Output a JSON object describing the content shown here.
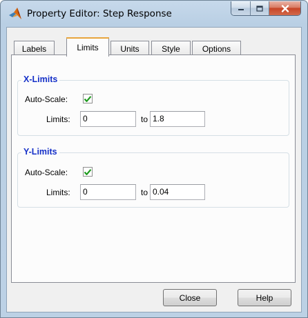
{
  "window": {
    "title": "Property Editor: Step Response",
    "controls": {
      "minimize": "minimize",
      "maximize": "maximize",
      "close": "close"
    }
  },
  "tabs": [
    {
      "label": "Labels",
      "active": false
    },
    {
      "label": "Limits",
      "active": true
    },
    {
      "label": "Units",
      "active": false
    },
    {
      "label": "Style",
      "active": false
    },
    {
      "label": "Options",
      "active": false
    }
  ],
  "xlimits": {
    "title": "X-Limits",
    "autoscale_label": "Auto-Scale:",
    "autoscale_checked": true,
    "limits_label": "Limits:",
    "from": "0",
    "to_label": "to",
    "to": "1.8"
  },
  "ylimits": {
    "title": "Y-Limits",
    "autoscale_label": "Auto-Scale:",
    "autoscale_checked": true,
    "limits_label": "Limits:",
    "from": "0",
    "to_label": "to",
    "to": "0.04"
  },
  "buttons": {
    "close": "Close",
    "help": "Help"
  },
  "colors": {
    "group_title": "#1530c8",
    "check": "#1e9a1e",
    "close_button": "#c74426",
    "tab_highlight": "#e8a43b"
  }
}
